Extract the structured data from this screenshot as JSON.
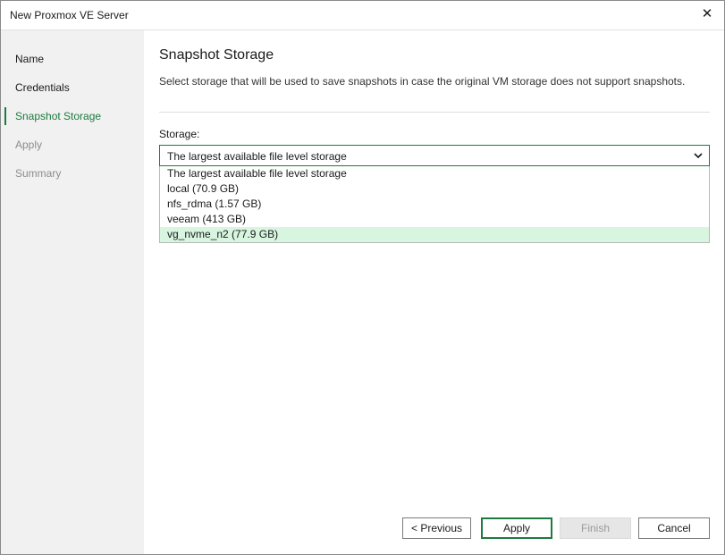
{
  "window": {
    "title": "New Proxmox VE Server"
  },
  "colors": {
    "accent": "#1d7a3e",
    "hover": "#d8f5e0",
    "sidebar_bg": "#f1f1f1"
  },
  "sidebar": {
    "items": [
      {
        "label": "Name",
        "state": "done"
      },
      {
        "label": "Credentials",
        "state": "done"
      },
      {
        "label": "Snapshot Storage",
        "state": "active"
      },
      {
        "label": "Apply",
        "state": "disabled"
      },
      {
        "label": "Summary",
        "state": "disabled"
      }
    ]
  },
  "main": {
    "title": "Snapshot Storage",
    "description": "Select storage that will be used to save snapshots in case the original VM storage does not support snapshots.",
    "storage": {
      "label": "Storage:",
      "selected": "The largest available file level storage",
      "options": [
        "The largest available file level storage",
        "local (70.9 GB)",
        "nfs_rdma (1.57 GB)",
        "veeam (413 GB)",
        "vg_nvme_n2 (77.9 GB)"
      ],
      "hovered_index": 4
    }
  },
  "buttons": {
    "previous": "< Previous",
    "apply": "Apply",
    "finish": "Finish",
    "cancel": "Cancel"
  }
}
